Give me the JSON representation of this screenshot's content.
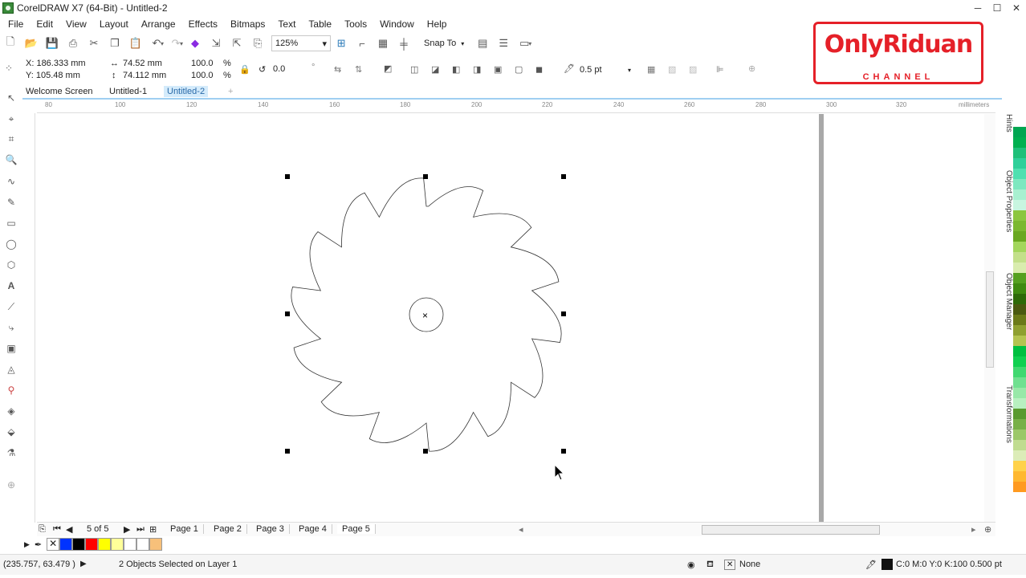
{
  "app": {
    "title": "CorelDRAW X7 (64-Bit) - Untitled-2",
    "window_buttons": [
      "─",
      "☐",
      "✕"
    ]
  },
  "menu": [
    "File",
    "Edit",
    "View",
    "Layout",
    "Arrange",
    "Effects",
    "Bitmaps",
    "Text",
    "Table",
    "Tools",
    "Window",
    "Help"
  ],
  "toolbar": {
    "zoom": "125%",
    "snap_to": "Snap To"
  },
  "property_bar": {
    "x": "X: 186.333 mm",
    "y": "Y: 105.48 mm",
    "width": "74.52 mm",
    "height": "74.112 mm",
    "scale_w": "100.0",
    "scale_h": "100.0",
    "percent": "%",
    "angle": "0.0",
    "degree": "°",
    "outline": "0.5 pt"
  },
  "doc_tabs": [
    "Welcome Screen",
    "Untitled-1",
    "Untitled-2"
  ],
  "ruler": {
    "top_ticks": [
      "80",
      "100",
      "120",
      "140",
      "160",
      "180",
      "200",
      "220",
      "240",
      "260",
      "280",
      "300",
      "320"
    ],
    "unit": "millimeters"
  },
  "pages": {
    "counter": "5 of 5",
    "tabs": [
      "Page 1",
      "Page 2",
      "Page 3",
      "Page 4",
      "Page 5"
    ]
  },
  "status": {
    "coords": "(235.757, 63.479 )",
    "selection": "2 Objects Selected on Layer 1",
    "fill": "None",
    "outline": "C:0 M:0 Y:0 K:100  0.500 pt"
  },
  "dockers": [
    "Hints",
    "Object Properties",
    "Object Manager",
    "Transformations"
  ],
  "logo": {
    "name": "OnlyRiduan",
    "sub": "CHANNEL"
  },
  "colors": {
    "accent": "#e52028",
    "tab_active_bg": "#d4ebfb"
  }
}
